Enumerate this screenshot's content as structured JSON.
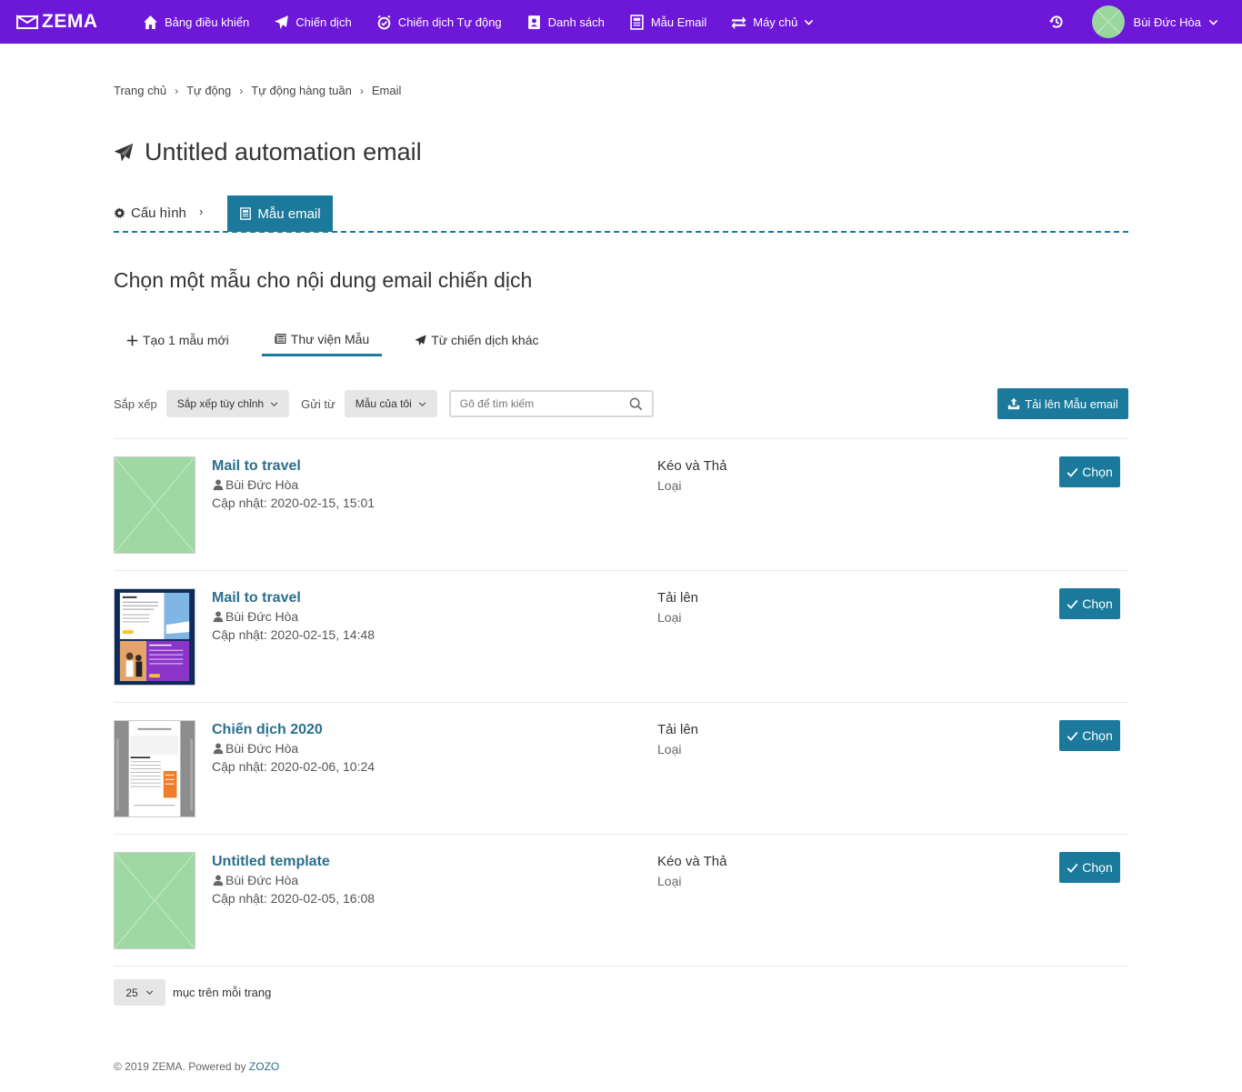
{
  "app": {
    "brand": "ZEMA"
  },
  "nav": {
    "items": [
      {
        "label": "Bảng điều khiển",
        "icon": "home-icon"
      },
      {
        "label": "Chiến dịch",
        "icon": "paper-plane-icon"
      },
      {
        "label": "Chiến dịch Tự động",
        "icon": "alarm-clock-icon"
      },
      {
        "label": "Danh sách",
        "icon": "contact-book-icon"
      },
      {
        "label": "Mẫu Email",
        "icon": "template-icon"
      },
      {
        "label": "Máy chủ",
        "icon": "exchange-icon"
      }
    ],
    "user_name": "Bùi Đức Hòa"
  },
  "breadcrumb": [
    "Trang chủ",
    "Tự động",
    "Tự động hàng tuần",
    "Email"
  ],
  "page_title": "Untitled automation email",
  "steps": {
    "config": "Cấu hình",
    "template": "Mẫu email"
  },
  "section_title": "Chọn một mẫu cho nội dung email chiến dịch",
  "tabs": [
    "Tạo 1 mẫu mới",
    "Thư viện Mẫu",
    "Từ chiến dịch khác"
  ],
  "filters": {
    "sort_label": "Sắp xếp",
    "sort_value": "Sắp xếp tùy chỉnh",
    "from_label": "Gửi từ",
    "from_value": "Mẫu của tôi",
    "search_placeholder": "Gõ để tìm kiếm",
    "upload_label": "Tải lên Mẫu email"
  },
  "templates": [
    {
      "title": "Mail to travel",
      "author": "Bùi Đức Hòa",
      "updated": "Cập nhật: 2020-02-15, 15:01",
      "type": "Kéo và Thả",
      "type_label": "Loại",
      "choose": "Chọn",
      "thumb": "placeholder"
    },
    {
      "title": "Mail to travel",
      "author": "Bùi Đức Hòa",
      "updated": "Cập nhật: 2020-02-15, 14:48",
      "type": "Tải lên",
      "type_label": "Loại",
      "choose": "Chọn",
      "thumb": "travel"
    },
    {
      "title": "Chiến dịch 2020",
      "author": "Bùi Đức Hòa",
      "updated": "Cập nhật: 2020-02-06, 10:24",
      "type": "Tải lên",
      "type_label": "Loại",
      "choose": "Chọn",
      "thumb": "newsletter"
    },
    {
      "title": "Untitled template",
      "author": "Bùi Đức Hòa",
      "updated": "Cập nhật: 2020-02-05, 16:08",
      "type": "Kéo và Thả",
      "type_label": "Loại",
      "choose": "Chọn",
      "thumb": "placeholder"
    }
  ],
  "pager": {
    "per_page": "25",
    "label": "mục trên mỗi trang"
  },
  "footer": {
    "text": "© 2019 ZEMA. Powered by",
    "link": "ZOZO"
  },
  "colors": {
    "brand": "#6d17d8",
    "accent": "#1b7a9b",
    "link": "#2c6e8c",
    "placeholder": "#9ed8a2"
  }
}
